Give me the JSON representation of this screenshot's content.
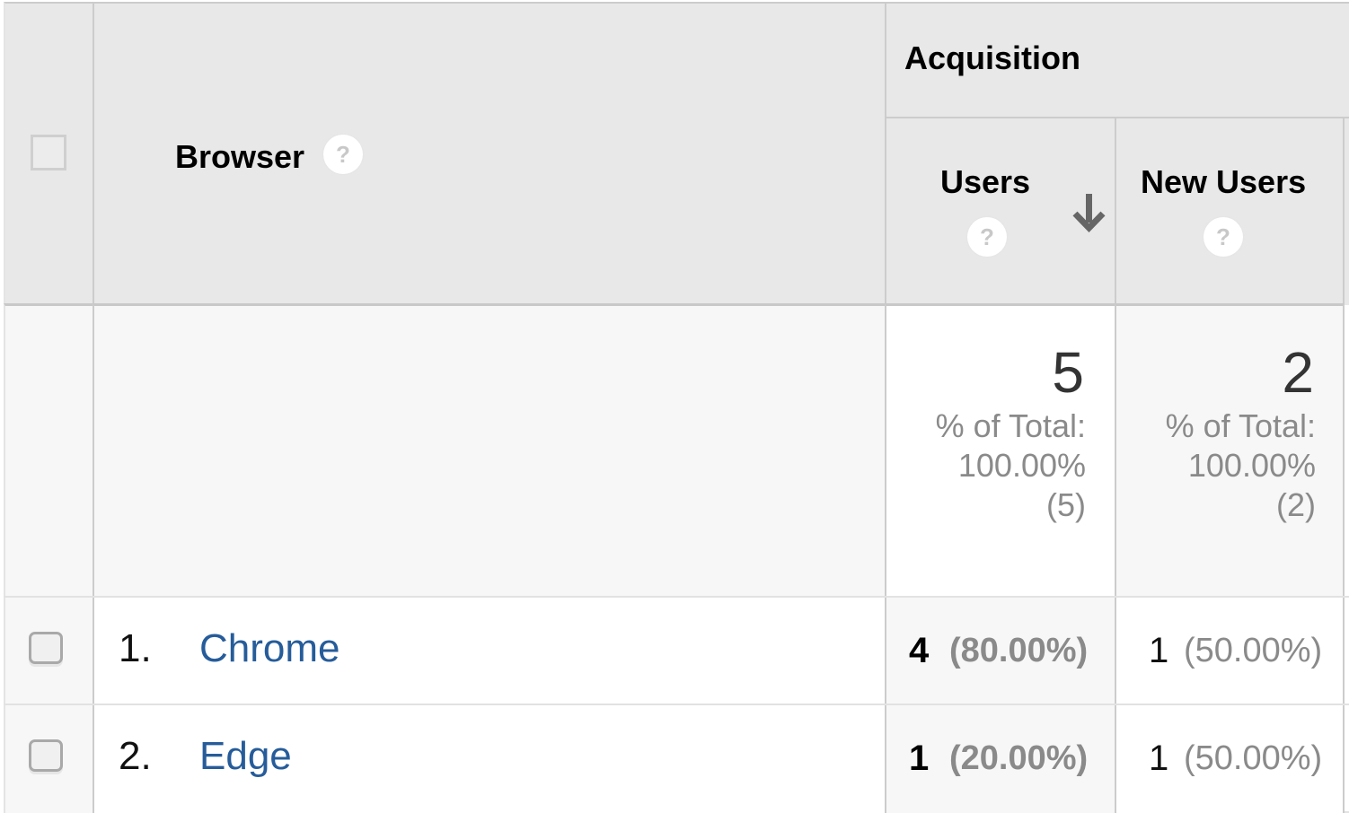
{
  "header": {
    "dimension_label": "Browser",
    "group_label": "Acquisition",
    "columns": [
      {
        "label": "Users",
        "sorted": "descending"
      },
      {
        "label": "New Users"
      }
    ],
    "help_glyph": "?"
  },
  "totals": {
    "users": {
      "value": "5",
      "pct_label": "% of Total:",
      "pct_value": "100.00%",
      "total": "(5)"
    },
    "new_users": {
      "value": "2",
      "pct_label": "% of Total:",
      "pct_value": "100.00%",
      "total": "(2)"
    }
  },
  "rows": [
    {
      "index": "1.",
      "browser": "Chrome",
      "users": "4",
      "users_pct": "(80.00%)",
      "new_users": "1",
      "new_users_pct": "(50.00%)"
    },
    {
      "index": "2.",
      "browser": "Edge",
      "users": "1",
      "users_pct": "(20.00%)",
      "new_users": "1",
      "new_users_pct": "(50.00%)"
    }
  ],
  "colors": {
    "header_bg": "#e8e8e8",
    "link": "#265c9a",
    "muted_text": "#8a8a8a"
  }
}
